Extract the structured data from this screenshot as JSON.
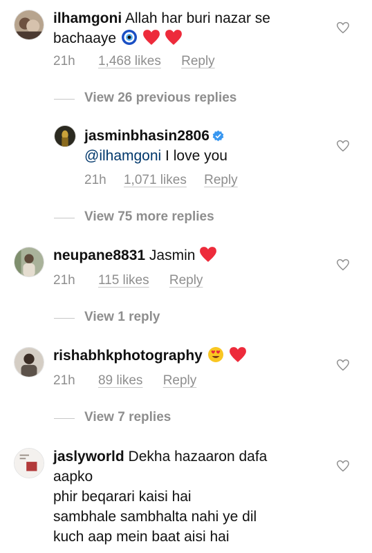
{
  "comments": [
    {
      "username": "ilhamgoni",
      "line1": "Allah har buri nazar se",
      "line2": "bachaaye",
      "time": "21h",
      "likes": "1,468 likes",
      "reply": "Reply",
      "emojis": [
        "nazar-amulet-emoji",
        "red-heart-emoji",
        "red-heart-emoji"
      ]
    },
    {
      "username": "jasminbhasin2806",
      "verified": true,
      "mention": "@ilhamgoni",
      "text": " I love you",
      "time": "21h",
      "likes": "1,071 likes",
      "reply": "Reply"
    },
    {
      "username": "neupane8831",
      "text": "Jasmin",
      "time": "21h",
      "likes": "115 likes",
      "reply": "Reply",
      "emojis": [
        "red-heart-emoji"
      ]
    },
    {
      "username": "rishabhkphotography",
      "time": "21h",
      "likes": "89 likes",
      "reply": "Reply",
      "emojis": [
        "heart-eyes-emoji",
        "red-heart-emoji"
      ]
    },
    {
      "username": "jaslyworld",
      "line1": "Dekha hazaaron dafa",
      "line2": "aapko",
      "line3": "phir beqarari kaisi hai",
      "line4": "sambhale sambhalta nahi ye dil",
      "line5": "kuch aap mein baat aisi hai"
    }
  ],
  "view_links": {
    "previous_replies": "View 26 previous replies",
    "more_replies": "View 75 more replies",
    "one_reply": "View 1 reply",
    "seven_replies": "View 7 replies"
  },
  "colors": {
    "text": "#111111",
    "secondary": "#8e8e8e",
    "mention": "#00376b",
    "verified": "#3897f0",
    "heart": "#ed2b3b"
  }
}
